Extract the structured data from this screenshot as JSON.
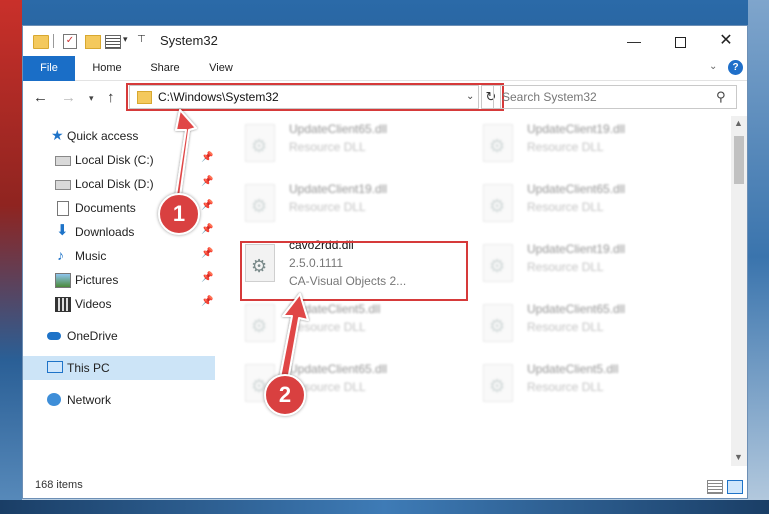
{
  "window": {
    "title": "System32"
  },
  "ribbon": {
    "tabs": [
      "File",
      "Home",
      "Share",
      "View"
    ]
  },
  "nav": {
    "address": "C:\\Windows\\System32",
    "search_placeholder": "Search System32"
  },
  "sidebar": {
    "items": [
      {
        "label": "Quick access"
      },
      {
        "label": "Local Disk (C:)"
      },
      {
        "label": "Local Disk (D:)"
      },
      {
        "label": "Documents"
      },
      {
        "label": "Downloads"
      },
      {
        "label": "Music"
      },
      {
        "label": "Pictures"
      },
      {
        "label": "Videos"
      },
      {
        "label": "OneDrive"
      },
      {
        "label": "This PC"
      },
      {
        "label": "Network"
      }
    ]
  },
  "files": [
    {
      "name": "UpdateClient65.dll",
      "desc": "Resource DLL"
    },
    {
      "name": "UpdateClient19.dll",
      "desc": "Resource DLL"
    },
    {
      "name": "UpdateClient19.dll",
      "desc": "Resource DLL"
    },
    {
      "name": "UpdateClient65.dll",
      "desc": "Resource DLL"
    },
    {
      "name": "cavo2rdd.dll",
      "version": "2.5.0.1111",
      "company": "CA-Visual Objects 2..."
    },
    {
      "name": "UpdateClient19.dll",
      "desc": "Resource DLL"
    },
    {
      "name": "UpdateClient5.dll",
      "desc": "Resource DLL"
    },
    {
      "name": "UpdateClient65.dll",
      "desc": "Resource DLL"
    },
    {
      "name": "UpdateClient65.dll",
      "desc": "Resource DLL"
    },
    {
      "name": "UpdateClient5.dll",
      "desc": "Resource DLL"
    }
  ],
  "status": {
    "count": "168 items"
  },
  "annotations": {
    "step1": "1",
    "step2": "2",
    "color": "#d63a3a"
  }
}
